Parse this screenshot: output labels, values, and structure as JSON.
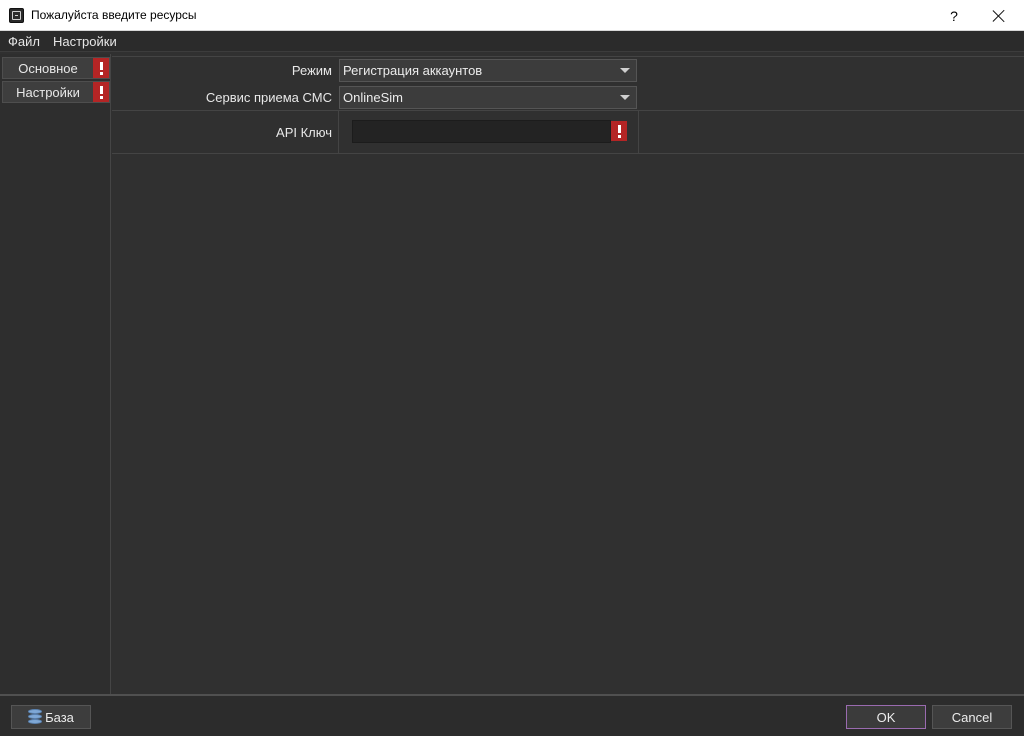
{
  "window": {
    "title": "Пожалуйста введите ресурсы",
    "help_label": "?",
    "icon": "app-icon",
    "close_icon": "close-icon"
  },
  "menu": {
    "items": [
      "Файл",
      "Настройки"
    ]
  },
  "sidebar": {
    "items": [
      {
        "label": "Основное",
        "warning": true,
        "icon": "warning-icon"
      },
      {
        "label": "Настройки",
        "warning": true,
        "icon": "warning-icon"
      }
    ]
  },
  "form": {
    "mode": {
      "label": "Режим",
      "value": "Регистрация аккаунтов"
    },
    "sms_service": {
      "label": "Сервис приема СМС",
      "value": "OnlineSim"
    },
    "api_key": {
      "label": "API Ключ",
      "value": "",
      "warning": true
    }
  },
  "footer": {
    "db_label": "База",
    "db_icon": "database-icon",
    "ok_label": "OK",
    "cancel_label": "Cancel"
  },
  "colors": {
    "warning": "#b42525",
    "ok_border": "#9a6bb0",
    "background": "#303030"
  }
}
